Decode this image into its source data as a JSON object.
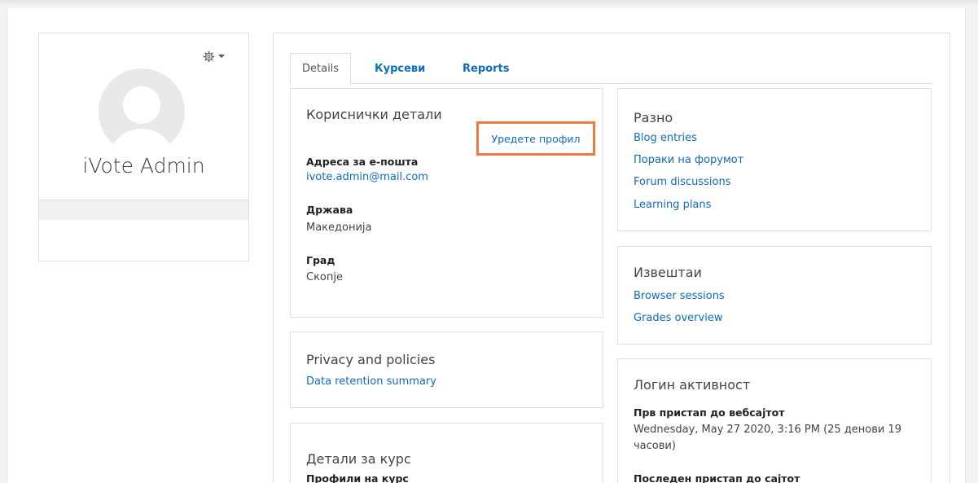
{
  "profile": {
    "name": "iVote Admin"
  },
  "tabs": [
    {
      "label": "Details"
    },
    {
      "label": "Курсеви"
    },
    {
      "label": "Reports"
    }
  ],
  "user_details": {
    "title": "Кориснички детали",
    "edit_profile": "Уредете профил",
    "email_label": "Адреса за е-пошта",
    "email_value": "ivote.admin@mail.com",
    "country_label": "Држава",
    "country_value": "Македонија",
    "city_label": "Град",
    "city_value": "Скопје"
  },
  "privacy": {
    "title": "Privacy and policies",
    "link": "Data retention summary"
  },
  "course_details": {
    "title": "Детали за курс",
    "profiles_label": "Профили на курс"
  },
  "misc": {
    "title": "Разно",
    "links": [
      "Blog entries",
      "Пораки на форумот",
      "Forum discussions",
      "Learning plans"
    ]
  },
  "reports": {
    "title": "Извештаи",
    "links": [
      "Browser sessions",
      "Grades overview"
    ]
  },
  "login": {
    "title": "Логин активност",
    "first_access_label": "Прв пристап до вебсајтот",
    "first_access_value": "Wednesday, May 27 2020, 3:16 PM  (25 денови 19 часови)",
    "last_access_label": "Последен пристап до сајтот"
  },
  "colors": {
    "link": "#0f6cbf",
    "highlight": "#f07a3b"
  }
}
